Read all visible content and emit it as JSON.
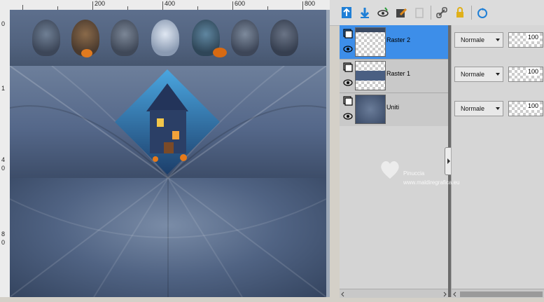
{
  "ruler": {
    "labels": [
      "200",
      "400",
      "600",
      "800"
    ],
    "left_labels": [
      "0",
      "1",
      "4",
      "0",
      "8",
      "0"
    ]
  },
  "toolbar": {
    "icons": [
      "new-raster-layer-icon",
      "merge-down-icon",
      "visibility-icon",
      "edit-mask-icon",
      "link-icon",
      "chain-link-icon",
      "lock-icon",
      "refresh-icon"
    ]
  },
  "layers": [
    {
      "name": "Raster 2",
      "mode": "Normale",
      "opacity": "100",
      "selected": true
    },
    {
      "name": "Raster 1",
      "mode": "Normale",
      "opacity": "100",
      "selected": false
    },
    {
      "name": "Uniti",
      "mode": "Normale",
      "opacity": "100",
      "selected": false
    }
  ],
  "watermark": {
    "name": "Pinuccia",
    "url": "www.maldiregrafica.eu"
  },
  "colors": {
    "selection": "#3d8ee9",
    "panel": "#d4d0c8",
    "art_base": "#52637f"
  }
}
